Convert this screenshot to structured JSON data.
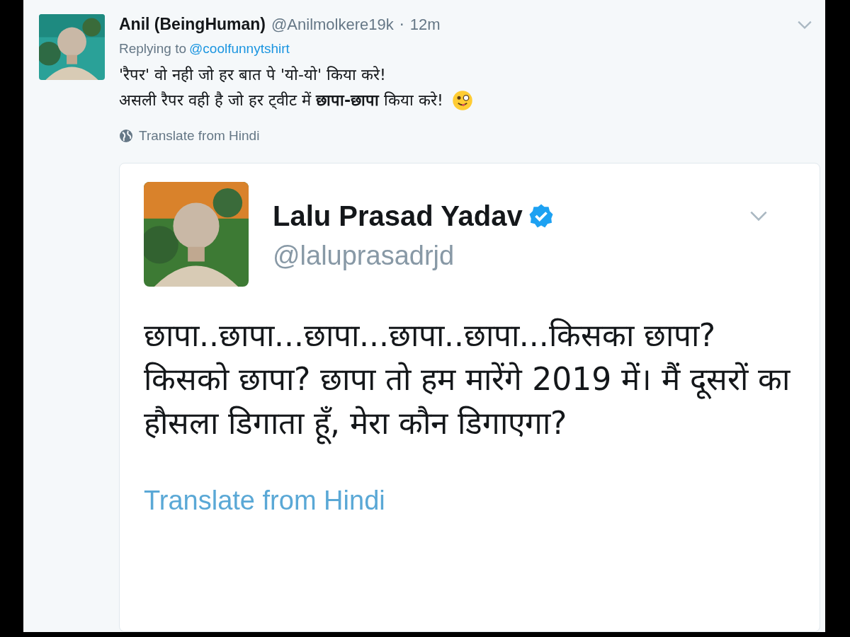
{
  "tweet": {
    "name": "Anil (BeingHuman)",
    "handle": "@Anilmolkere19k",
    "separator": "·",
    "time": "12m",
    "replying_label": "Replying to",
    "replying_to": "@coolfunnytshirt",
    "lines": [
      "'रैपर' वो नही जो हर बात पे 'यो-यो' किया करे!",
      "असली रैपर वही है जो हर ट्वीट में **छापा-छापा** किया करे!"
    ],
    "translate": "Translate from Hindi",
    "quoted": {
      "name": "Lalu Prasad Yadav",
      "verified": true,
      "handle": "@laluprasadrjd",
      "text": "छापा..छापा...छापा...छापा..छापा...किसका छापा? किसको छापा? छापा तो हम मारेंगे 2019 में। मैं दूसरों का हौसला डिगाता हूँ, मेरा कौन डिगाएगा?",
      "translate": "Translate from Hindi"
    }
  }
}
